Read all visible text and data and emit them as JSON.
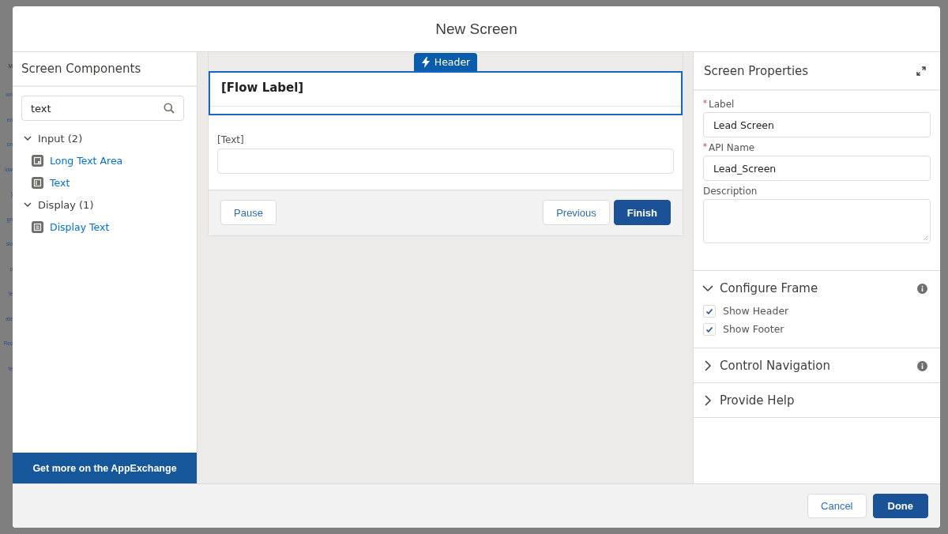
{
  "background": {
    "fragments": [
      "M",
      "ion",
      "en",
      "on",
      "low",
      ")",
      "gn",
      "sio",
      "o",
      "te",
      "ate",
      "Rec",
      "te"
    ]
  },
  "modal": {
    "title": "New Screen"
  },
  "components": {
    "title": "Screen Components",
    "search": {
      "value": "text"
    },
    "groups": [
      {
        "label": "Input (2)",
        "expanded": true,
        "items": [
          {
            "label": "Long Text Area",
            "kind": "textarea"
          },
          {
            "label": "Text",
            "kind": "input"
          }
        ]
      },
      {
        "label": "Display (1)",
        "expanded": true,
        "items": [
          {
            "label": "Display Text",
            "kind": "display"
          }
        ]
      }
    ],
    "appexchange": "Get more on the AppExchange"
  },
  "canvas": {
    "header_tab": "Header",
    "flow_label": "[Flow Label]",
    "field_label": "[Text]",
    "buttons_left": [
      {
        "label": "Pause",
        "kind": "neutral"
      }
    ],
    "buttons_right": [
      {
        "label": "Previous",
        "kind": "neutral"
      },
      {
        "label": "Finish",
        "kind": "brand"
      }
    ]
  },
  "properties": {
    "title": "Screen Properties",
    "fields": [
      {
        "label": "Label",
        "required_mark": "*",
        "value": "Lead Screen",
        "kind": "input"
      },
      {
        "label": "API Name",
        "required_mark": "*",
        "value": "Lead_Screen",
        "kind": "input"
      },
      {
        "label": "Description",
        "kind": "textarea"
      }
    ],
    "sections": [
      {
        "title": "Configure Frame",
        "expanded": true,
        "info": true,
        "options": [
          {
            "label": "Show Header",
            "checked": true
          },
          {
            "label": "Show Footer",
            "checked": true
          }
        ]
      },
      {
        "title": "Control Navigation",
        "expanded": false,
        "info": true
      },
      {
        "title": "Provide Help",
        "expanded": false,
        "info": false
      }
    ]
  },
  "footer": {
    "buttons": [
      {
        "label": "Cancel",
        "kind": "neutral"
      },
      {
        "label": "Done",
        "kind": "brand"
      }
    ]
  }
}
